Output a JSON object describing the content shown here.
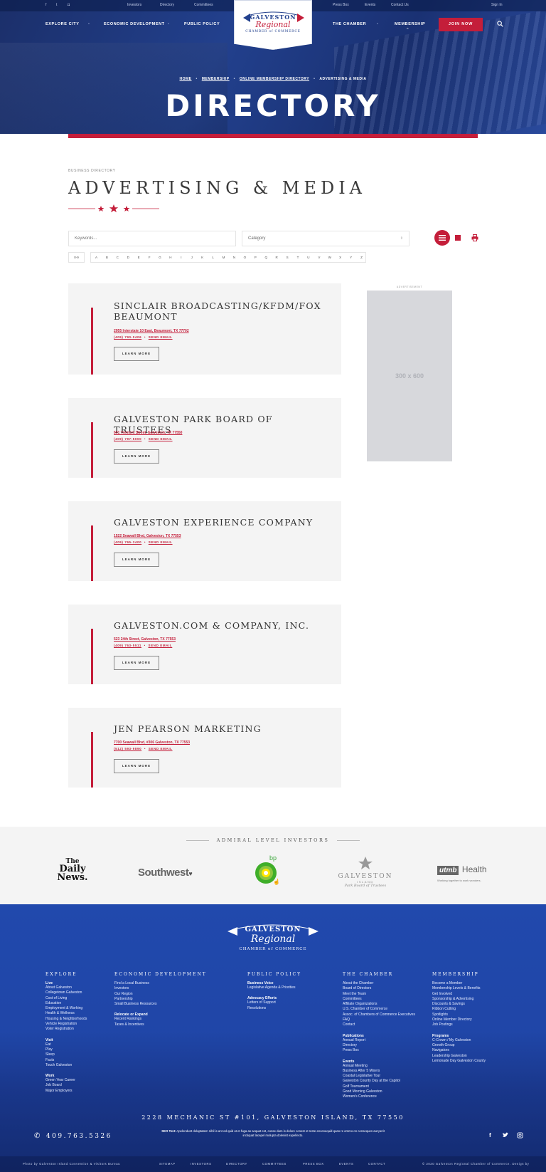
{
  "topbar": {
    "social": [
      "facebook-icon",
      "twitter-icon",
      "instagram-icon"
    ],
    "links": [
      "Investors",
      "Directory",
      "Committees",
      "Press Box",
      "Events",
      "Contact Us",
      "Sign In"
    ]
  },
  "nav": {
    "left": [
      "EXPLORE CITY",
      "ECONOMIC DEVELOPMENT",
      "PUBLIC POLICY"
    ],
    "right": [
      "THE CHAMBER",
      "MEMBERSHIP"
    ],
    "join": "JOIN NOW"
  },
  "logo": {
    "line1": "GALVESTON",
    "line2": "Regional",
    "line3": "CHAMBER of COMMERCE"
  },
  "breadcrumb": [
    "HOME",
    "MEMBERSHIP",
    "ONLINE MEMBERSHIP DIRECTORY",
    "ADVERTISING & MEDIA"
  ],
  "hero_title": "DIRECTORY",
  "eyebrow": "BUSINESS DIRECTORY",
  "page_title": "ADVERTISING & MEDIA",
  "filters": {
    "keywords_placeholder": "Keywords...",
    "category_placeholder": "Category"
  },
  "alphabet": [
    "0-9",
    "A",
    "B",
    "C",
    "D",
    "E",
    "F",
    "G",
    "H",
    "I",
    "J",
    "K",
    "L",
    "M",
    "N",
    "O",
    "P",
    "Q",
    "R",
    "S",
    "T",
    "U",
    "V",
    "W",
    "X",
    "Y",
    "Z"
  ],
  "listings": [
    {
      "name": "SINCLAIR BROADCASTING/KFDM/FOX BEAUMONT",
      "address": "2955 Interstate 10 East, Beaumont, TX 77702",
      "phone": "(409) 790-0406",
      "email": "SEND EMAIL",
      "button": "LEARN MORE"
    },
    {
      "name": "GALVESTON PARK BOARD OF TRUSTEES",
      "address": "601 Tremont Street, Galveston, TX 77550",
      "phone": "(409) 797-5000",
      "email": "SEND EMAIL",
      "button": "LEARN MORE"
    },
    {
      "name": "GALVESTON EXPERIENCE COMPANY",
      "address": "1522 Seawall Blvd, Galveston, TX 77553",
      "phone": "(409) 765-3400",
      "email": "SEND EMAIL",
      "button": "LEARN MORE"
    },
    {
      "name": "GALVESTON.COM & COMPANY, INC.",
      "address": "523 24th Street, Galveston, TX 77553",
      "phone": "(409) 763-5511",
      "email": "SEND EMAIL",
      "button": "LEARN MORE"
    },
    {
      "name": "JEN PEARSON MARKETING",
      "address": "7700 Seawall Blvd, #306 Galveston, TX 77553",
      "phone": "(512) 593-9890",
      "email": "SEND EMAIL",
      "button": "LEARN MORE"
    }
  ],
  "ad": {
    "label": "ADVERTISEMENT",
    "size": "300 x 600"
  },
  "investors": {
    "title": "ADMIRAL LEVEL INVESTORS",
    "daily_news": [
      "The",
      "Daily",
      "News."
    ],
    "southwest": "Southwest",
    "bp": "bp",
    "park_board": [
      "GALVESTON",
      "ISLAND",
      "Park Board of Trustees"
    ],
    "utmb": [
      "utmb",
      "Health",
      "Working together to work wonders."
    ]
  },
  "footer": {
    "cols": [
      {
        "title": "EXPLORE",
        "groups": [
          {
            "h": "Live",
            "items": [
              "About Galveston",
              "Collegetown Galveston",
              "Cost of Living",
              "Education",
              "Employment & Working",
              "Health & Wellness",
              "Housing & Neighborhoods",
              "Vehicle Registration",
              "Voter Registration"
            ]
          },
          {
            "h": "Visit",
            "items": [
              "Eat",
              "Play",
              "Sleep",
              "Facts",
              "Touch Galveston"
            ]
          },
          {
            "h": "Work",
            "items": [
              "Green Year Career",
              "Job Board",
              "Major Employers"
            ]
          }
        ]
      },
      {
        "title": "ECONOMIC DEVELOPMENT",
        "groups": [
          {
            "h": "",
            "items": [
              "Find a Local Business",
              "Investors",
              "Our Region",
              "Partnership",
              "Small Business Resources"
            ]
          },
          {
            "h": "Relocate or Expand",
            "items": [
              "Recent Rankings",
              "Taxes & Incentives"
            ]
          }
        ]
      },
      {
        "title": "PUBLIC POLICY",
        "groups": [
          {
            "h": "Business Voice",
            "items": [
              "Legislative Agenda & Priorities"
            ]
          },
          {
            "h": "Advocacy Efforts",
            "items": [
              "Letters of Support",
              "Resolutions"
            ]
          }
        ]
      },
      {
        "title": "THE CHAMBER",
        "groups": [
          {
            "h": "",
            "items": [
              "About the Chamber",
              "Board of Directors",
              "Meet the Team",
              "Committees",
              "Affiliate Organizations",
              "U.S. Chamber of Commerce",
              "Assoc. of Chambers of Commerce Executives",
              "FAQ",
              "Contact"
            ]
          },
          {
            "h": "Publications",
            "items": [
              "Annual Report",
              "Directory",
              "Press Box"
            ]
          },
          {
            "h": "Events",
            "items": [
              "Annual Meeting",
              "Business After 5 Mixers",
              "Coastal Legislative Tour",
              "Galveston County Day at the Capitol",
              "Golf Tournament",
              "Good Morning Galveston",
              "Women's Conference"
            ]
          }
        ]
      },
      {
        "title": "MEMBERSHIP",
        "groups": [
          {
            "h": "",
            "items": [
              "Become a Member",
              "Membership Levels & Benefits",
              "Get Involved",
              "Sponsorship & Advertising",
              "Discounts & Savings",
              "Ribbon Cutting",
              "Spotlights",
              "Online Member Directory",
              "Job Postings"
            ]
          },
          {
            "h": "Programs",
            "items": [
              "C-Crown / My Galveston",
              "Growth Group",
              "Navigators",
              "Leadership Galveston",
              "Lemonade Day Galveston County"
            ]
          }
        ]
      }
    ],
    "address": "2228 MECHANIC ST #101, GALVESTON ISLAND, TX 77550",
    "phone": "409.763.5326",
    "seo_label": "SEO Text:",
    "seo_text": "Apelendunt doluptatem nihil is ant od quid ut et fuga as acquat est, conse dam is dolore conest et reste encesequid quas re ommo on conseques aut perit inctiquat lacepel molupta dolenist expellecto.",
    "bottom_left": "Photo by Galveston Island Convention & Visitors Bureau",
    "bottom_links": [
      "SITEMAP",
      "INVESTORS",
      "DIRECTORY",
      "COMMITTEES",
      "PRESS BOX",
      "EVENTS",
      "CONTACT"
    ],
    "copyright": "© 2020 Galveston Regional Chamber of Commerce. Design by"
  }
}
